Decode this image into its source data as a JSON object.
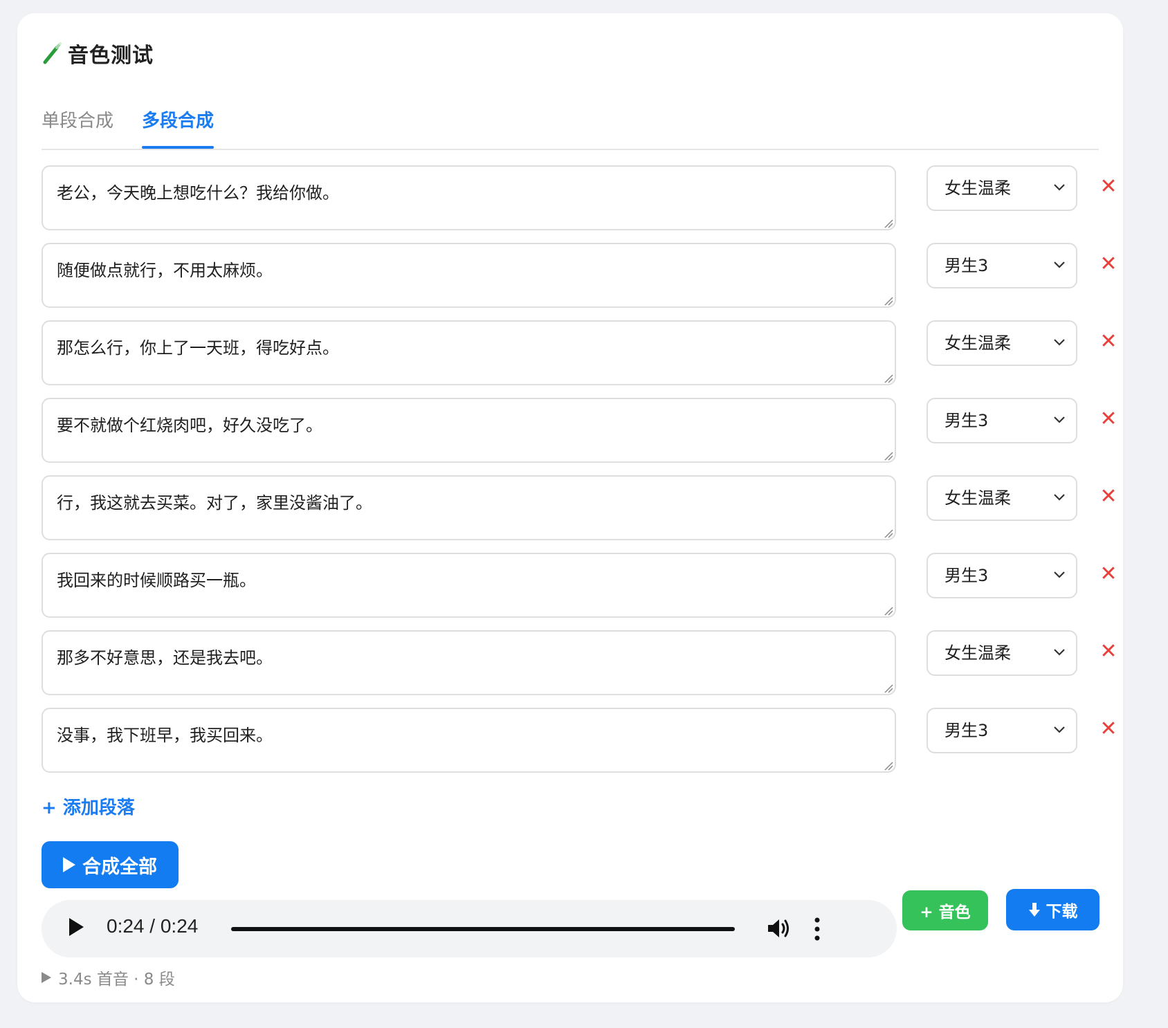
{
  "header": {
    "title": "音色测试",
    "icon": "test-tube-icon"
  },
  "tabs": [
    {
      "label": "单段合成",
      "active": false
    },
    {
      "label": "多段合成",
      "active": true
    }
  ],
  "segments": [
    {
      "text": "老公，今天晚上想吃什么？我给你做。",
      "voice": "女生温柔"
    },
    {
      "text": "随便做点就行，不用太麻烦。",
      "voice": "男生3"
    },
    {
      "text": "那怎么行，你上了一天班，得吃好点。",
      "voice": "女生温柔"
    },
    {
      "text": "要不就做个红烧肉吧，好久没吃了。",
      "voice": "男生3"
    },
    {
      "text": "行，我这就去买菜。对了，家里没酱油了。",
      "voice": "女生温柔"
    },
    {
      "text": "我回来的时候顺路买一瓶。",
      "voice": "男生3"
    },
    {
      "text": "那多不好意思，还是我去吧。",
      "voice": "女生温柔"
    },
    {
      "text": "没事，我下班早，我买回来。",
      "voice": "男生3"
    }
  ],
  "delete_glyph": "✕",
  "actions": {
    "add_segment": "+ 添加段落",
    "synthesize_all": "合成全部",
    "add_voice": "+ 音色",
    "download": "下载"
  },
  "player": {
    "current": "0:24",
    "separator": "/",
    "duration": "0:24",
    "progress": 1.0
  },
  "status": {
    "text": "3.4s 首音 · 8 段"
  },
  "colors": {
    "accent": "#127cf0",
    "success": "#35c25a",
    "danger": "#e8413b"
  }
}
